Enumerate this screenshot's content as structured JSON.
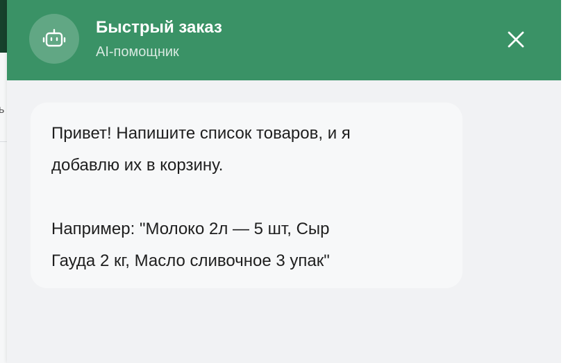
{
  "background_page": {
    "partial_char": "ь"
  },
  "colors": {
    "header_bg": "#3a9266",
    "panel_bg": "#f1f2f4",
    "bubble_bg": "#f7f8f9",
    "text": "#1e1e1e"
  },
  "header": {
    "icon": "robot-icon",
    "title": "Быстрый заказ",
    "subtitle": "AI-помощник",
    "close_icon": "close-icon"
  },
  "chat": {
    "messages": [
      {
        "role": "assistant",
        "line1": "Привет! Напишите список товаров, и я",
        "line2": "добавлю их в корзину.",
        "line3": "Например: \"Молоко 2л — 5 шт, Сыр",
        "line4": "Гауда 2 кг, Масло сливочное 3 упак\""
      }
    ]
  }
}
